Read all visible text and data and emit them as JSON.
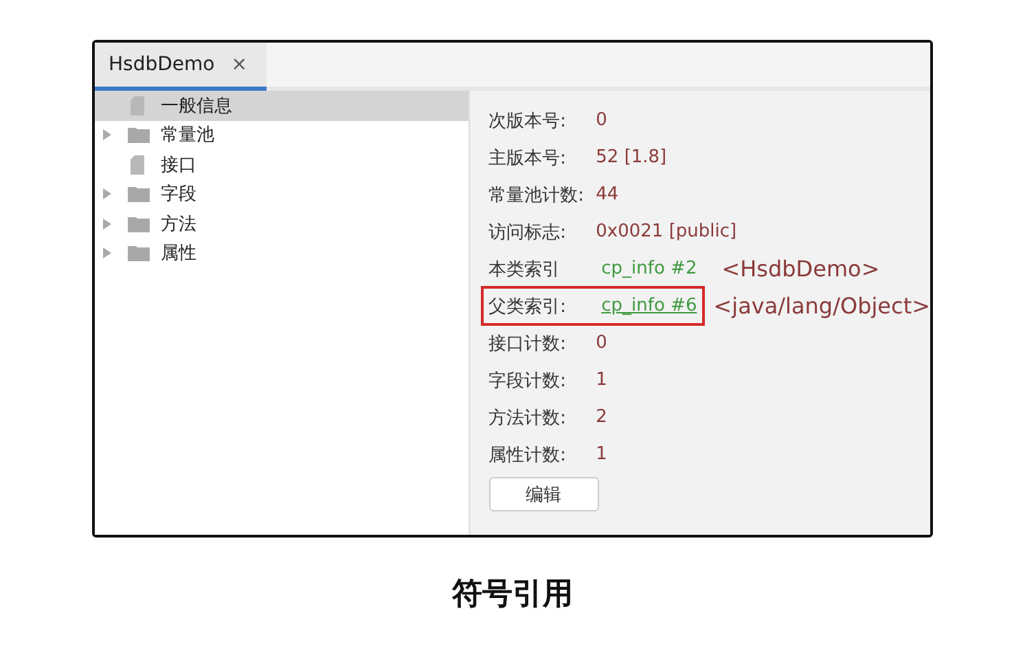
{
  "tabs": [
    {
      "label": "HsdbDemo",
      "close": "×",
      "selected": true
    }
  ],
  "tree": [
    {
      "label": "一般信息",
      "kind": "file",
      "selected": true
    },
    {
      "label": "常量池",
      "kind": "folder",
      "expanded": false,
      "selected": false
    },
    {
      "label": "接口",
      "kind": "file",
      "selected": false
    },
    {
      "label": "字段",
      "kind": "folder",
      "expanded": false,
      "selected": false
    },
    {
      "label": "方法",
      "kind": "folder",
      "expanded": false,
      "selected": false
    },
    {
      "label": "属性",
      "kind": "folder",
      "expanded": false,
      "selected": false
    }
  ],
  "fields": [
    {
      "label": "次版本号:",
      "kind": "text",
      "value": "0",
      "highlighted": false
    },
    {
      "label": "主版本号:",
      "kind": "text",
      "value": "52 [1.8]",
      "highlighted": false
    },
    {
      "label": "常量池计数:",
      "kind": "text",
      "value": "44",
      "highlighted": false
    },
    {
      "label": "访问标志:",
      "kind": "text",
      "value": "0x0021 [public]",
      "highlighted": false
    },
    {
      "label": "本类索引",
      "kind": "link",
      "value": "cp_info #2",
      "extra": "<HsdbDemo>",
      "underlined": false,
      "highlighted": false
    },
    {
      "label": "父类索引:",
      "kind": "link",
      "value": "cp_info #6",
      "extra": "<java/lang/Object>",
      "underlined": true,
      "highlighted": true
    },
    {
      "label": "接口计数:",
      "kind": "text",
      "value": "0",
      "highlighted": false
    },
    {
      "label": "字段计数:",
      "kind": "text",
      "value": "1",
      "highlighted": false
    },
    {
      "label": "方法计数:",
      "kind": "text",
      "value": "2",
      "highlighted": false
    },
    {
      "label": "属性计数:",
      "kind": "text",
      "value": "1",
      "highlighted": false
    }
  ],
  "edit_button": "编辑",
  "caption": "符号引用"
}
